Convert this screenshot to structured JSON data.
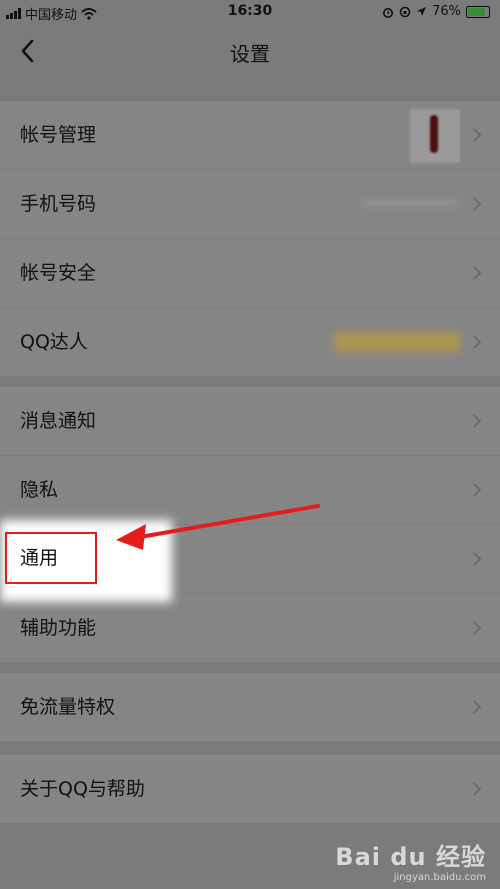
{
  "status_bar": {
    "carrier": "中国移动",
    "time": "16:30",
    "battery": "76%"
  },
  "nav": {
    "title": "设置"
  },
  "groups": [
    {
      "items": [
        {
          "label": "帐号管理"
        },
        {
          "label": "手机号码"
        },
        {
          "label": "帐号安全"
        },
        {
          "label": "QQ达人"
        }
      ]
    },
    {
      "items": [
        {
          "label": "消息通知"
        },
        {
          "label": "隐私"
        },
        {
          "label": "通用"
        },
        {
          "label": "辅助功能"
        }
      ]
    },
    {
      "items": [
        {
          "label": "免流量特权"
        }
      ]
    },
    {
      "items": [
        {
          "label": "关于QQ与帮助"
        }
      ]
    }
  ],
  "annotation": {
    "highlight_color": "#e51c1c"
  },
  "watermark": {
    "brand": "Bai du 经验",
    "url": "jingyan.baidu.com"
  }
}
